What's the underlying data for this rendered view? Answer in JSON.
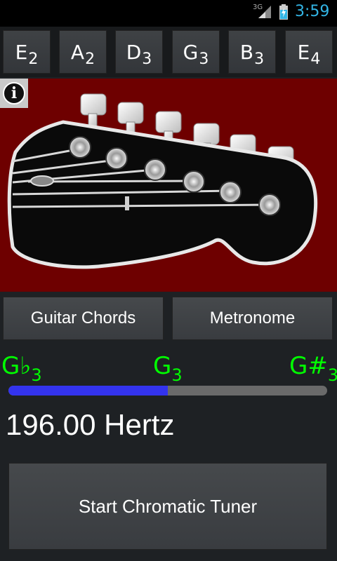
{
  "status": {
    "network": "3G",
    "time": "3:59"
  },
  "strings": [
    {
      "note": "E",
      "octave": "2"
    },
    {
      "note": "A",
      "octave": "2"
    },
    {
      "note": "D",
      "octave": "3"
    },
    {
      "note": "G",
      "octave": "3"
    },
    {
      "note": "B",
      "octave": "3"
    },
    {
      "note": "E",
      "octave": "4"
    }
  ],
  "info_icon": "info-icon",
  "actions": {
    "chords_label": "Guitar Chords",
    "metronome_label": "Metronome"
  },
  "tuning": {
    "flat_note": "G♭",
    "flat_octave": "3",
    "center_note": "G",
    "center_octave": "3",
    "sharp_note": "G#",
    "sharp_octave": "3",
    "meter_fraction": 0.5,
    "frequency": "196.00 Hertz"
  },
  "tuner_button": "Start Chromatic Tuner",
  "colors": {
    "note_green": "#00ff00",
    "meter_blue": "#3333ee",
    "clock_blue": "#33b5e5",
    "headstock_bg": "#6e0000"
  }
}
